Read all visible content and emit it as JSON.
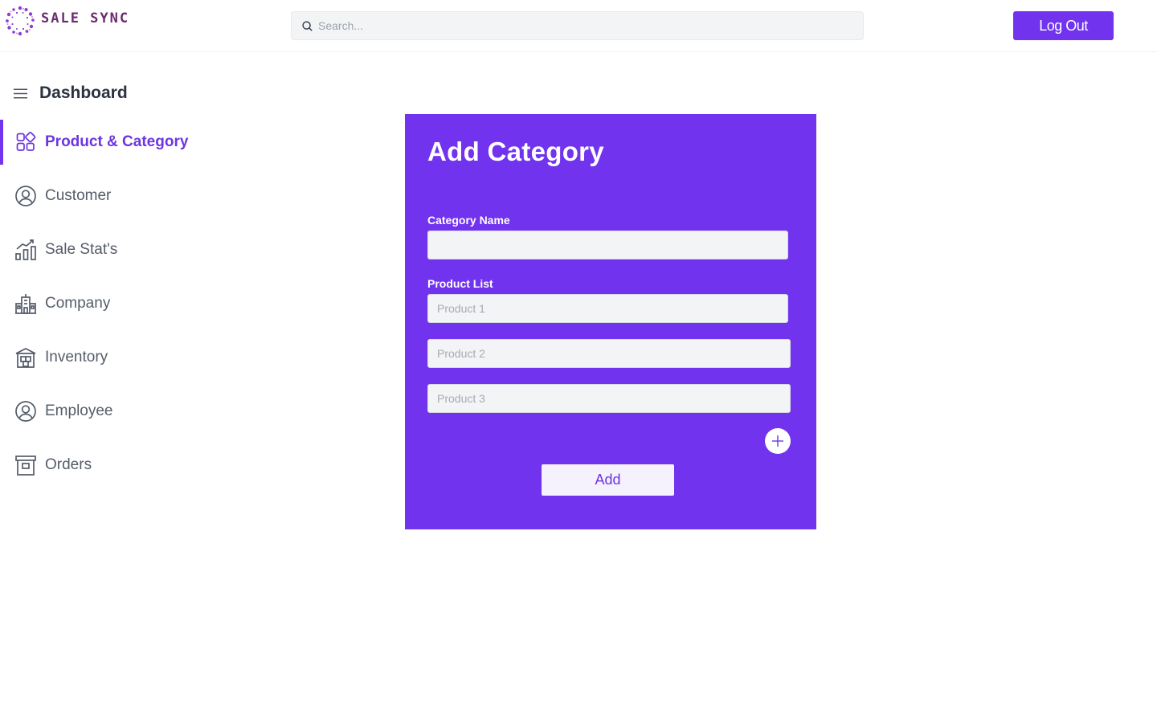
{
  "brand": {
    "name": "SALE SYNC",
    "accent": "#7133ee",
    "logo_color": "#6b2c6e"
  },
  "header": {
    "search_placeholder": "Search...",
    "search_icon": "search-icon",
    "logout_label": "Log Out"
  },
  "sidebar": {
    "title": "Dashboard",
    "menu_icon": "hamburger-menu-icon",
    "items": [
      {
        "label": "Product & Category",
        "icon": "grid-shapes-icon",
        "active": true
      },
      {
        "label": "Customer",
        "icon": "user-circle-icon",
        "active": false
      },
      {
        "label": "Sale Stat's",
        "icon": "bar-chart-trend-icon",
        "active": false
      },
      {
        "label": "Company",
        "icon": "buildings-icon",
        "active": false
      },
      {
        "label": "Inventory",
        "icon": "warehouse-icon",
        "active": false
      },
      {
        "label": "Employee",
        "icon": "user-circle-icon",
        "active": false
      },
      {
        "label": "Orders",
        "icon": "archive-box-icon",
        "active": false
      }
    ]
  },
  "form": {
    "title": "Add Category",
    "category_name_label": "Category Name",
    "category_name_value": "",
    "product_list_label": "Product List",
    "products": [
      {
        "placeholder": "Product 1",
        "value": ""
      },
      {
        "placeholder": "Product 2",
        "value": ""
      },
      {
        "placeholder": "Product 3",
        "value": ""
      }
    ],
    "add_product_icon": "plus-icon",
    "submit_label": "Add"
  }
}
